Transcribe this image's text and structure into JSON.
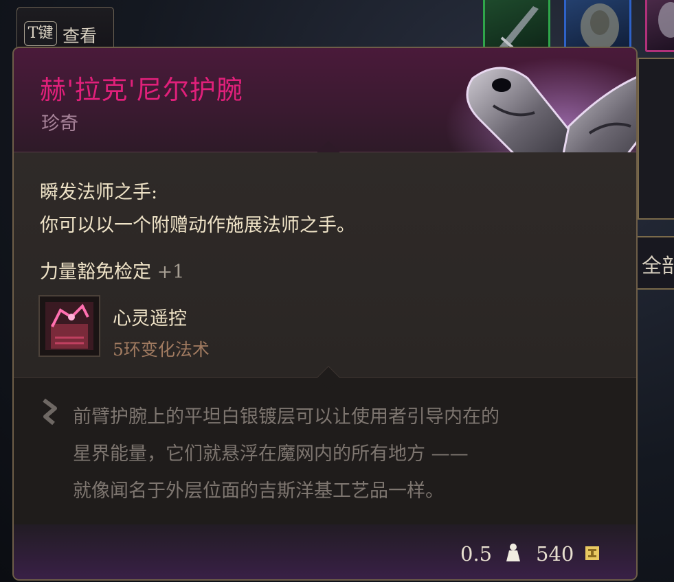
{
  "keyhint": {
    "key": "T键",
    "label": "查看"
  },
  "right_panel": {
    "label": "全部"
  },
  "item": {
    "name": "赫'拉克'尼尔护腕",
    "rarity": "珍奇",
    "passive_title": "瞬发法师之手:",
    "passive_desc": "你可以以一个附赠动作施展法师之手。",
    "stat_label": "力量豁免检定",
    "stat_bonus": "+1",
    "spell_name": "心灵遥控",
    "spell_level": "5环变化法术",
    "lore": [
      "前臂护腕上的平坦白银镀层可以让使用者引导内在的",
      "星界能量，它们就悬浮在魔网内的所有地方 ——",
      "就像闻名于外层位面的吉斯洋基工艺品一样。"
    ],
    "weight": "0.5",
    "price": "540"
  },
  "colors": {
    "rarity_name": "#e0207a",
    "slot_green": "#2fa64a",
    "slot_blue": "#2e62c8",
    "slot_pink": "#b0317a"
  },
  "icons": {
    "weight": "weight-icon",
    "price": "gold-coin-icon",
    "spell": "telekinesis-icon",
    "lore": "lore-quill-icon",
    "item": "bracers-icon"
  }
}
